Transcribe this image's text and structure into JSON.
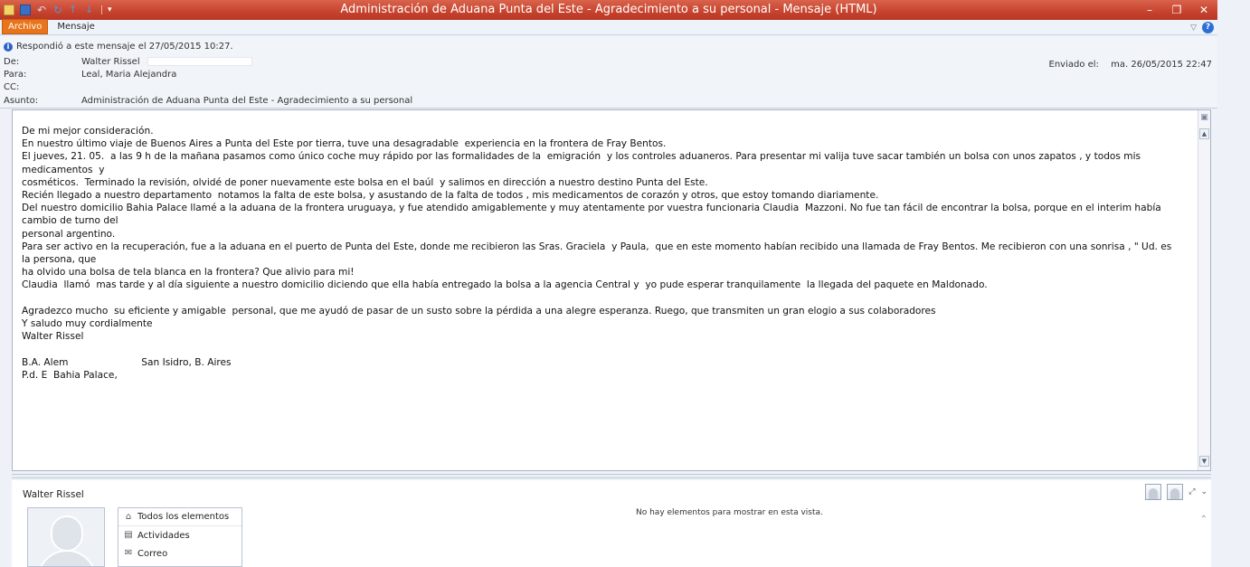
{
  "window": {
    "title": "Administración de Aduana Punta del Este -  Agradecimiento a su personal  -  Mensaje (HTML)",
    "controls": {
      "minimize": "–",
      "restore": "❐",
      "close": "✕"
    }
  },
  "quick_access": {
    "icons": [
      "mail-icon",
      "save-icon",
      "undo-icon",
      "redo-icon",
      "arrow-up-icon",
      "arrow-down-icon",
      "customize-icon"
    ],
    "undo_glyph": "↶",
    "redo_glyph": "↻",
    "up_glyph": "↑",
    "down_glyph": "↓",
    "customize_glyph": "▾"
  },
  "ribbon": {
    "tabs": [
      {
        "label": "Archivo",
        "active": true
      },
      {
        "label": "Mensaje",
        "active": false
      }
    ],
    "collapse_glyph": "▽",
    "help_glyph": "?",
    "accent": "#e8741b"
  },
  "header": {
    "info": "Respondió a este mensaje el 27/05/2015 10:27.",
    "info_glyph": "i",
    "from_label": "De:",
    "from": "Walter Rissel",
    "to_label": "Para:",
    "to": "Leal, Maria Alejandra",
    "cc_label": "CC:",
    "cc": "",
    "subject_label": "Asunto:",
    "subject": "Administración de Aduana Punta del Este -  Agradecimiento a su personal",
    "sent_label": "Enviado el:",
    "sent": "ma. 26/05/2015 22:47"
  },
  "message": {
    "lines": [
      "De mi mejor consideración.",
      "En nuestro último viaje de Buenos Aires a Punta del Este por tierra, tuve una desagradable  experiencia en la frontera de Fray Bentos.",
      "El jueves, 21. 05.  a las 9 h de la mañana pasamos como único coche muy rápido por las formalidades de la  emigración  y los controles aduaneros. Para presentar mi valija tuve sacar también un bolsa con unos zapatos , y todos mis medicamentos  y",
      "cosméticos.  Terminado la revisión, olvidé de poner nuevamente este bolsa en el baúl  y salimos en dirección a nuestro destino Punta del Este.",
      "Recién llegado a nuestro departamento  notamos la falta de este bolsa, y asustando de la falta de todos , mis medicamentos de corazón y otros, que estoy tomando diariamente.",
      "Del nuestro domicilio Bahia Palace llamé a la aduana de la frontera uruguaya, y fue atendido amigablemente y muy atentamente por vuestra funcionaria Claudia  Mazzoni. No fue tan fácil de encontrar la bolsa, porque en el interim había cambio de turno del",
      "personal argentino.",
      "Para ser activo en la recuperación, fue a la aduana en el puerto de Punta del Este, donde me recibieron las Sras. Graciela  y Paula,  que en este momento habían recibido una llamada de Fray Bentos. Me recibieron con una sonrisa , \" Ud. es la persona, que",
      "ha olvido una bolsa de tela blanca en la frontera? Que alivio para mi!",
      "Claudia  llamó  mas tarde y al día siguiente a nuestro domicilio diciendo que ella había entregado la bolsa a la agencia Central y  yo pude esperar tranquilamente  la llegada del paquete en Maldonado.",
      "",
      "Agradezco mucho  su eficiente y amigable  personal, que me ayudó de pasar de un susto sobre la pérdida a una alegre esperanza. Ruego, que transmiten un gran elogio a sus colaboradores",
      "Y saludo muy cordialmente",
      "Walter Rissel",
      "",
      "B.A. Alem                        San Isidro, B. Aires",
      "P.d. E  Bahia Palace,"
    ]
  },
  "people_pane": {
    "name": "Walter Rissel",
    "items": [
      {
        "label": "Todos los elementos",
        "icon": "home-icon",
        "glyph": "⌂"
      },
      {
        "label": "Actividades",
        "icon": "activities-icon",
        "glyph": "▤"
      },
      {
        "label": "Correo",
        "icon": "mail-icon",
        "glyph": "✉"
      }
    ],
    "empty_text": "No hay elementos para mostrar en esta vista.",
    "expand_glyph": "⤢",
    "collapse_glyph": "⌄",
    "scroll_glyph": "⌃"
  }
}
